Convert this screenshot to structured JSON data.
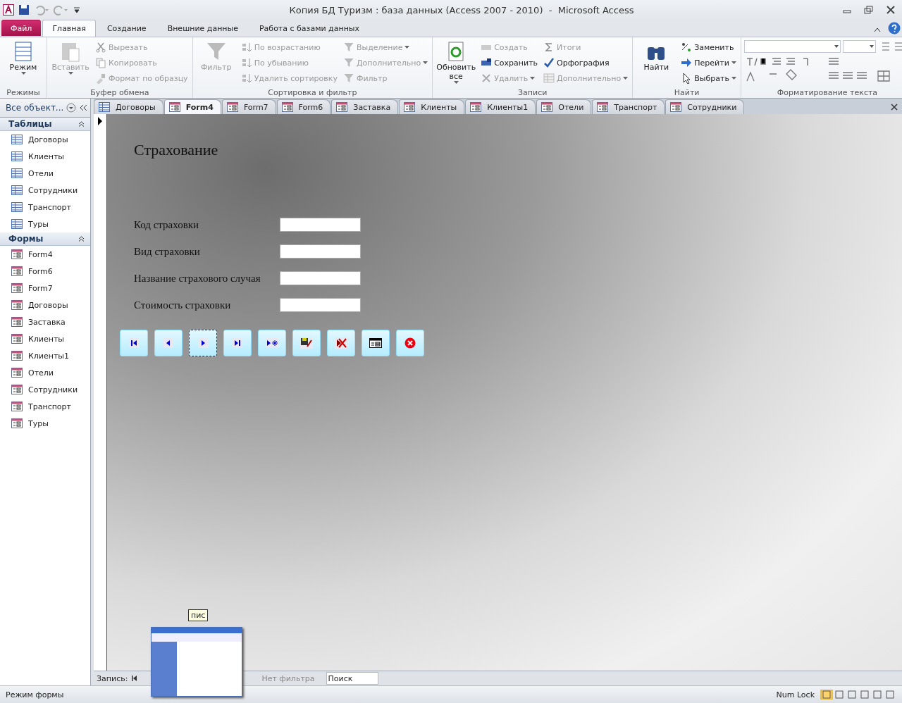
{
  "window": {
    "title": "Копия БД Туризм : база данных (Access 2007 - 2010)  -  Microsoft Access"
  },
  "ribbon_tabs": [
    {
      "label": "Файл",
      "kind": "file",
      "selected": false
    },
    {
      "label": "Главная",
      "kind": "tab",
      "selected": true
    },
    {
      "label": "Создание",
      "kind": "tab",
      "selected": false
    },
    {
      "label": "Внешние данные",
      "kind": "tab",
      "selected": false
    },
    {
      "label": "Работа с базами данных",
      "kind": "tab",
      "selected": false
    }
  ],
  "ribbon_groups": [
    {
      "label": "Режимы",
      "kind": "commands",
      "large": [
        {
          "label": "Режим",
          "disabled": false,
          "dropdown": true
        }
      ]
    },
    {
      "label": "Буфер обмена",
      "kind": "commands",
      "large": [
        {
          "label": "Вставить",
          "disabled": true,
          "dropdown": true
        }
      ],
      "columns": [
        [
          {
            "label": "Вырезать",
            "disabled": true,
            "dropdown": false
          },
          {
            "label": "Копировать",
            "disabled": true,
            "dropdown": false
          },
          {
            "label": "Формат по образцу",
            "disabled": true,
            "dropdown": false
          }
        ]
      ]
    },
    {
      "label": "Сортировка и фильтр",
      "kind": "commands",
      "large": [
        {
          "label": "Фильтр",
          "disabled": true,
          "dropdown": false
        }
      ],
      "columns": [
        [
          {
            "label": "По возрастанию",
            "disabled": true,
            "dropdown": false
          },
          {
            "label": "По убыванию",
            "disabled": true,
            "dropdown": false
          },
          {
            "label": "Удалить сортировку",
            "disabled": true,
            "dropdown": false
          }
        ],
        [
          {
            "label": "Выделение",
            "disabled": true,
            "dropdown": true
          },
          {
            "label": "Дополнительно",
            "disabled": true,
            "dropdown": true
          },
          {
            "label": "Фильтр",
            "disabled": true,
            "dropdown": false
          }
        ]
      ]
    },
    {
      "label": "Записи",
      "kind": "commands",
      "large": [
        {
          "label": "Обновить все",
          "disabled": false,
          "dropdown": true
        }
      ],
      "columns": [
        [
          {
            "label": "Создать",
            "disabled": true,
            "dropdown": false
          },
          {
            "label": "Сохранить",
            "disabled": false,
            "dropdown": false
          },
          {
            "label": "Удалить",
            "disabled": true,
            "dropdown": true
          }
        ],
        [
          {
            "label": "Итоги",
            "disabled": true,
            "dropdown": false
          },
          {
            "label": "Орфография",
            "disabled": false,
            "dropdown": false
          },
          {
            "label": "Дополнительно",
            "disabled": true,
            "dropdown": true
          }
        ]
      ]
    },
    {
      "label": "Найти",
      "kind": "commands",
      "large": [
        {
          "label": "Найти",
          "disabled": false,
          "dropdown": false
        }
      ],
      "columns": [
        [
          {
            "label": "Заменить",
            "disabled": false,
            "dropdown": false
          },
          {
            "label": "Перейти",
            "disabled": false,
            "dropdown": true
          },
          {
            "label": "Выбрать",
            "disabled": false,
            "dropdown": true
          }
        ]
      ]
    },
    {
      "label": "Форматирование текста",
      "kind": "formatting"
    }
  ],
  "nav_pane": {
    "header": "Все объект...",
    "groups": [
      {
        "label": "Таблицы",
        "kind": "table",
        "items": [
          "Договоры",
          "Клиенты",
          "Отели",
          "Сотрудники",
          "Транспорт",
          "Туры"
        ]
      },
      {
        "label": "Формы",
        "kind": "form",
        "items": [
          "Form4",
          "Form6",
          "Form7",
          "Договоры",
          "Заставка",
          "Клиенты",
          "Клиенты1",
          "Отели",
          "Сотрудники",
          "Транспорт",
          "Туры"
        ]
      }
    ]
  },
  "document_tabs": [
    {
      "label": "Договоры",
      "kind": "table",
      "selected": false
    },
    {
      "label": "Form4",
      "kind": "form",
      "selected": true
    },
    {
      "label": "Form7",
      "kind": "form",
      "selected": false
    },
    {
      "label": "Form6",
      "kind": "form",
      "selected": false
    },
    {
      "label": "Заставка",
      "kind": "form",
      "selected": false
    },
    {
      "label": "Клиенты",
      "kind": "form",
      "selected": false
    },
    {
      "label": "Клиенты1",
      "kind": "form",
      "selected": false
    },
    {
      "label": "Отели",
      "kind": "form",
      "selected": false
    },
    {
      "label": "Транспорт",
      "kind": "form",
      "selected": false
    },
    {
      "label": "Сотрудники",
      "kind": "form",
      "selected": false
    }
  ],
  "form": {
    "title": "Страхование",
    "fields": [
      {
        "label": "Код страховки"
      },
      {
        "label": "Вид страховки"
      },
      {
        "label": "Название страхового случая"
      },
      {
        "label": "Стоимость страховки"
      }
    ],
    "buttons": [
      {
        "kind": "first",
        "focused": false
      },
      {
        "kind": "prev",
        "focused": false
      },
      {
        "kind": "next",
        "focused": true
      },
      {
        "kind": "last",
        "focused": false
      },
      {
        "kind": "new",
        "focused": false
      },
      {
        "kind": "save",
        "focused": false
      },
      {
        "kind": "delete",
        "focused": false
      },
      {
        "kind": "form",
        "focused": false
      },
      {
        "kind": "close",
        "focused": false
      }
    ]
  },
  "record_nav": {
    "label": "Запись:",
    "filter": "Нет фильтра",
    "search": {
      "placeholder": "Поиск"
    }
  },
  "tooltip": "пис",
  "status_bar": {
    "mode": "Режим формы",
    "num_lock": "Num Lock"
  }
}
